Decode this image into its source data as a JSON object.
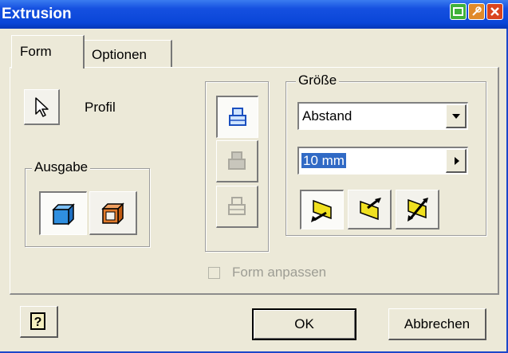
{
  "window": {
    "title": "Extrusion"
  },
  "tabs": [
    {
      "label": "Form",
      "active": true
    },
    {
      "label": "Optionen",
      "active": false
    }
  ],
  "profile": {
    "label": "Profil",
    "icon": "cursor-arrow-icon"
  },
  "ausgabe": {
    "legend": "Ausgabe",
    "buttons": [
      {
        "icon": "solid-output-icon",
        "selected": true
      },
      {
        "icon": "surface-output-icon",
        "selected": false
      }
    ]
  },
  "operation": {
    "buttons": [
      {
        "icon": "join-icon",
        "selected": true,
        "enabled": true
      },
      {
        "icon": "cut-icon",
        "selected": false,
        "enabled": false
      },
      {
        "icon": "intersect-icon",
        "selected": false,
        "enabled": false
      }
    ]
  },
  "size": {
    "legend": "Größe",
    "extent_type": "Abstand",
    "distance": "10 mm",
    "direction_buttons": [
      {
        "icon": "direction-1-icon",
        "selected": true
      },
      {
        "icon": "direction-2-icon",
        "selected": false
      },
      {
        "icon": "symmetric-icon",
        "selected": false
      }
    ]
  },
  "match_shape": {
    "label": "Form anpassen",
    "checked": false,
    "enabled": false
  },
  "footer": {
    "help_icon": "help-icon",
    "ok_label": "OK",
    "cancel_label": "Abbrechen"
  },
  "colors": {
    "titlebar": "#0a46d8",
    "dialog_bg": "#ece9d8",
    "selection": "#316ac5",
    "solid_blue": "#2f8fe0",
    "surface_orange": "#c05a10",
    "direction_yellow": "#f0e020"
  }
}
